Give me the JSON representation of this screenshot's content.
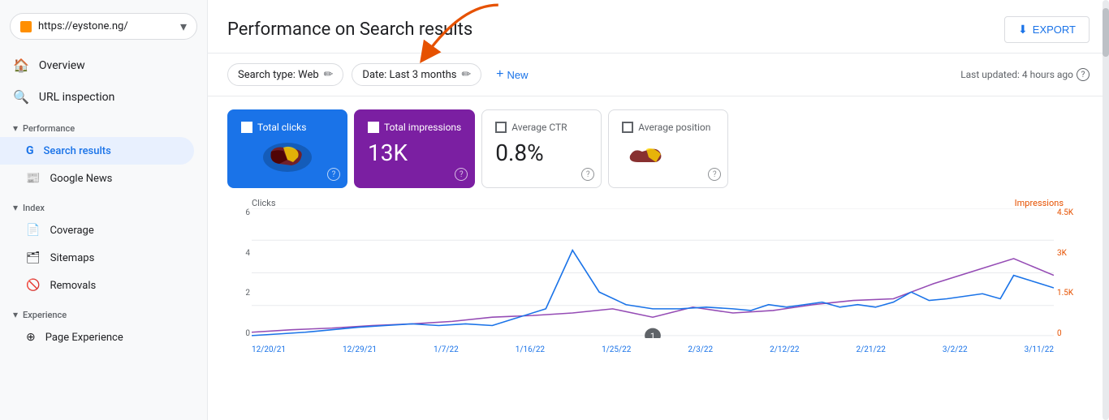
{
  "sidebar": {
    "url": "https://eystone.ng/",
    "nav": [
      {
        "id": "overview",
        "label": "Overview",
        "icon": "🏠",
        "active": false
      },
      {
        "id": "url-inspection",
        "label": "URL inspection",
        "icon": "🔍",
        "active": false
      }
    ],
    "sections": [
      {
        "id": "performance",
        "label": "Performance",
        "items": [
          {
            "id": "search-results",
            "label": "Search results",
            "icon": "G",
            "active": true
          },
          {
            "id": "google-news",
            "label": "Google News",
            "icon": "📰",
            "active": false
          }
        ]
      },
      {
        "id": "index",
        "label": "Index",
        "items": [
          {
            "id": "coverage",
            "label": "Coverage",
            "icon": "📄",
            "active": false
          },
          {
            "id": "sitemaps",
            "label": "Sitemaps",
            "icon": "🗂",
            "active": false
          },
          {
            "id": "removals",
            "label": "Removals",
            "icon": "🚫",
            "active": false
          }
        ]
      },
      {
        "id": "experience",
        "label": "Experience",
        "items": [
          {
            "id": "page-experience",
            "label": "Page Experience",
            "icon": "⊕",
            "active": false
          }
        ]
      }
    ]
  },
  "header": {
    "title": "Performance on Search results",
    "export_label": "EXPORT"
  },
  "filters": {
    "search_type": "Search type: Web",
    "date_range": "Date: Last 3 months",
    "new_label": "New",
    "last_updated": "Last updated: 4 hours ago"
  },
  "metrics": [
    {
      "id": "total-clicks",
      "label": "Total clicks",
      "value": "",
      "active": true,
      "color": "#1a73e8"
    },
    {
      "id": "total-impressions",
      "label": "Total impressions",
      "value": "13K",
      "active": true,
      "color": "#7b1fa2"
    },
    {
      "id": "average-ctr",
      "label": "Average CTR",
      "value": "0.8%",
      "active": false,
      "color": ""
    },
    {
      "id": "average-position",
      "label": "Average position",
      "value": "",
      "active": false,
      "color": ""
    }
  ],
  "chart": {
    "left_axis_label": "Clicks",
    "right_axis_label": "Impressions",
    "left_y_values": [
      "6",
      "4",
      "2",
      "0"
    ],
    "right_y_values": [
      "4.5K",
      "3K",
      "1.5K",
      "0"
    ],
    "x_labels": [
      "12/20/21",
      "12/29/21",
      "1/7/22",
      "1/16/22",
      "1/25/22",
      "2/3/22",
      "2/12/22",
      "2/21/22",
      "3/2/22",
      "3/11/22"
    ],
    "marker_value": "1"
  }
}
